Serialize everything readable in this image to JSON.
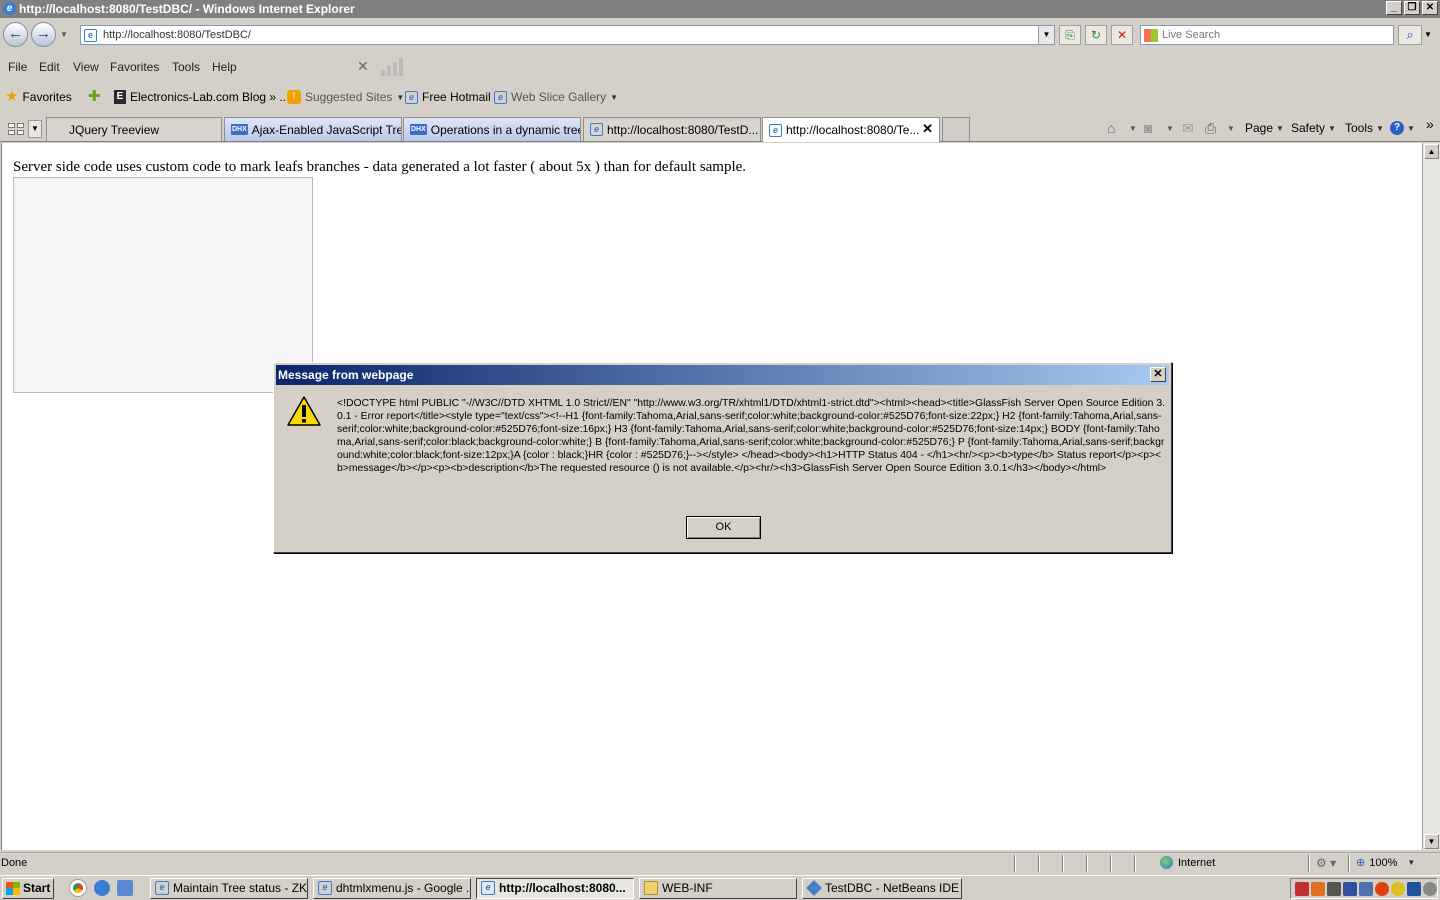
{
  "window": {
    "title": "http://localhost:8080/TestDBC/ - Windows Internet Explorer",
    "min_glyph": "_",
    "max_glyph": "❐",
    "close_glyph": "✕"
  },
  "nav": {
    "back_glyph": "←",
    "forward_glyph": "→",
    "address": "http://localhost:8080/TestDBC/",
    "search_placeholder": "Live Search"
  },
  "menu": {
    "file": "File",
    "edit": "Edit",
    "view": "View",
    "favorites": "Favorites",
    "tools": "Tools",
    "help": "Help"
  },
  "favorites_bar": {
    "favorites": "Favorites",
    "blog": "Electronics-Lab.com Blog » ...",
    "suggested": "Suggested Sites",
    "hotmail": "Free Hotmail",
    "webslice": "Web Slice Gallery"
  },
  "tabs": [
    {
      "label": "JQuery Treeview"
    },
    {
      "label": "Ajax-Enabled JavaScript Tre..."
    },
    {
      "label": "Operations in a dynamic tree"
    },
    {
      "label": "http://localhost:8080/TestD..."
    },
    {
      "label": "http://localhost:8080/Te..."
    }
  ],
  "commands": {
    "page": "Page",
    "safety": "Safety",
    "tools": "Tools",
    "help_glyph": "?",
    "overflow": "»"
  },
  "page": {
    "text": "Server side code uses custom code to mark leafs branches - data generated a lot faster ( about 5x ) than for default sample."
  },
  "dialog": {
    "title": "Message from webpage",
    "message": "<!DOCTYPE html PUBLIC \"-//W3C//DTD XHTML 1.0 Strict//EN\" \"http://www.w3.org/TR/xhtml1/DTD/xhtml1-strict.dtd\"><html><head><title>GlassFish Server Open Source Edition 3.0.1 - Error report</title><style type=\"text/css\"><!--H1 {font-family:Tahoma,Arial,sans-serif;color:white;background-color:#525D76;font-size:22px;} H2 {font-family:Tahoma,Arial,sans-serif;color:white;background-color:#525D76;font-size:16px;} H3 {font-family:Tahoma,Arial,sans-serif;color:white;background-color:#525D76;font-size:14px;} BODY {font-family:Tahoma,Arial,sans-serif;color:black;background-color:white;} B {font-family:Tahoma,Arial,sans-serif;color:white;background-color:#525D76;} P {font-family:Tahoma,Arial,sans-serif;background:white;color:black;font-size:12px;}A {color : black;}HR {color : #525D76;}--></style> </head><body><h1>HTTP Status 404 - </h1><hr/><p><b>type</b> Status report</p><p><b>message</b></p><p><b>description</b>The requested resource () is not available.</p><hr/><h3>GlassFish Server Open Source Edition 3.0.1</h3></body></html>",
    "ok_label": "OK",
    "close_glyph": "✕"
  },
  "status": {
    "text": "Done",
    "zone": "Internet",
    "zoom": "100%"
  },
  "taskbar": {
    "start": "Start",
    "tasks": [
      {
        "label": "Maintain Tree status - ZK..."
      },
      {
        "label": "dhtmlxmenu.js - Google ..."
      },
      {
        "label": "http://localhost:8080..."
      },
      {
        "label": "WEB-INF"
      },
      {
        "label": "TestDBC - NetBeans IDE ..."
      }
    ]
  },
  "colors": {
    "dialog_title_start": "#0a246a",
    "dialog_title_end": "#a6caf0",
    "chrome": "#d4d0c8"
  }
}
